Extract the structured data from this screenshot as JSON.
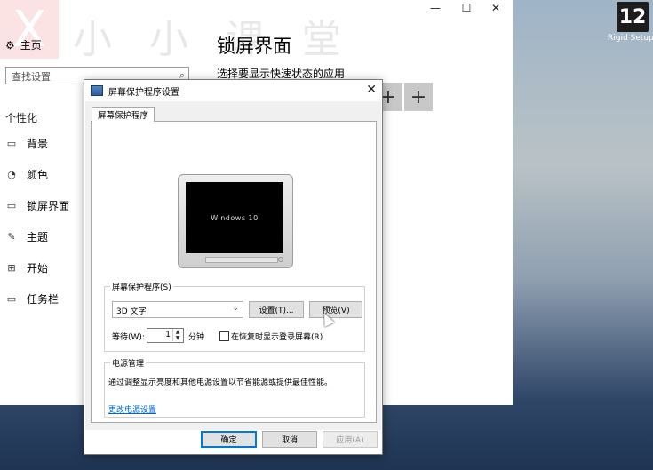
{
  "desktop": {
    "icon_text": "12",
    "icon_label": "Rigid Setup"
  },
  "settings": {
    "watermark_glyph": "X",
    "watermark_text": "小 小 课 堂",
    "win_min": "—",
    "win_max": "☐",
    "win_close": "✕",
    "home_label": "主页",
    "search_placeholder": "查找设置",
    "section_title": "个性化",
    "nav_items": [
      {
        "label": "背景",
        "icon": "image-icon"
      },
      {
        "label": "颜色",
        "icon": "palette-icon"
      },
      {
        "label": "锁屏界面",
        "icon": "lock-screen-icon"
      },
      {
        "label": "主题",
        "icon": "theme-icon"
      },
      {
        "label": "开始",
        "icon": "start-icon"
      },
      {
        "label": "任务栏",
        "icon": "taskbar-icon"
      }
    ],
    "page_title": "锁屏界面",
    "page_subtitle": "选择要显示快速状态的应用",
    "plus": "+"
  },
  "dialog": {
    "title": "屏幕保护程序设置",
    "close": "✕",
    "tab_label": "屏幕保护程序",
    "preview_text": "Windows 10",
    "screensaver_group_label": "屏幕保护程序(S)",
    "screensaver_selected": "3D 文字",
    "settings_button": "设置(T)...",
    "preview_button": "预览(V)",
    "wait_label": "等待(W):",
    "wait_value": "1",
    "minutes_label": "分钟",
    "resume_checkbox_label": "在恢复时显示登录屏幕(R)",
    "resume_checked": false,
    "power_group_label": "电源管理",
    "power_description": "通过调整显示亮度和其他电源设置以节省能源或提供最佳性能。",
    "power_link": "更改电源设置",
    "ok_button": "确定",
    "cancel_button": "取消",
    "apply_button": "应用(A)"
  }
}
